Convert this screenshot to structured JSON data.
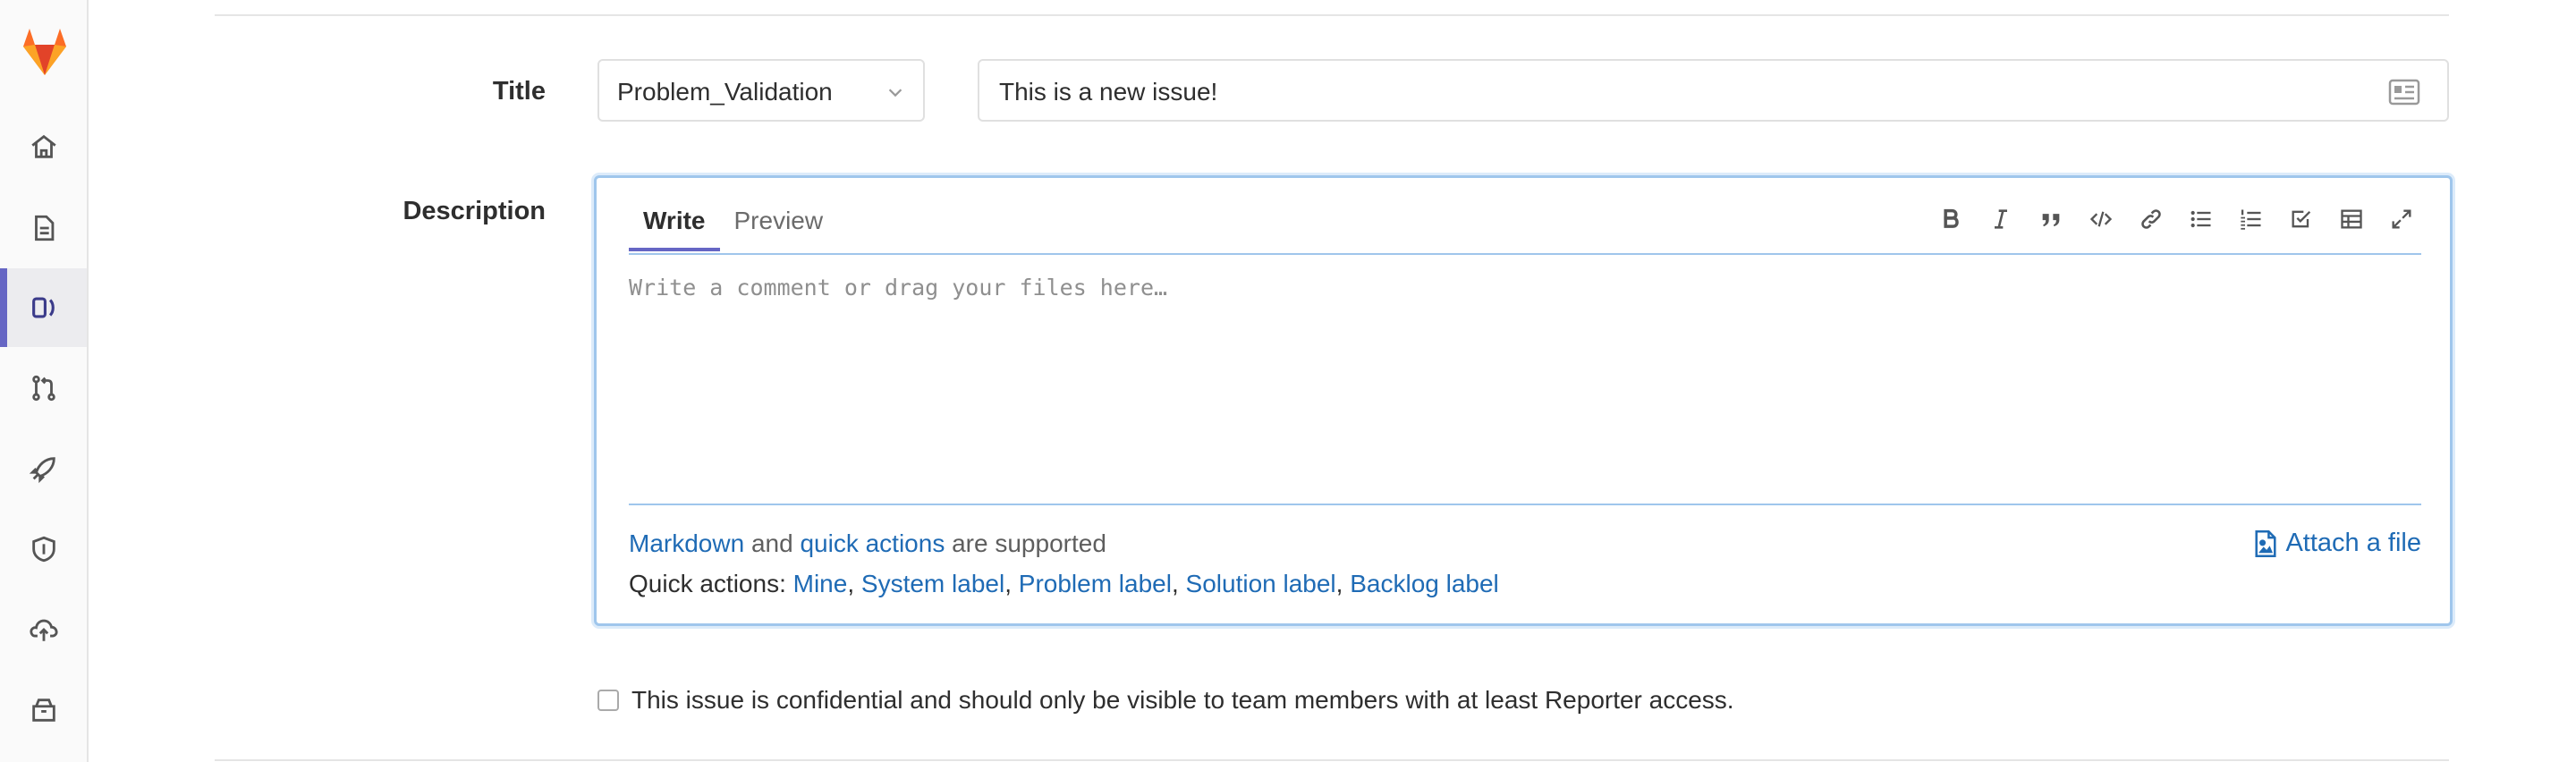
{
  "sidebar": {
    "items": [
      {
        "icon": "home-icon"
      },
      {
        "icon": "document-icon"
      },
      {
        "icon": "issues-icon",
        "active": true
      },
      {
        "icon": "merge-request-icon"
      },
      {
        "icon": "rocket-icon"
      },
      {
        "icon": "shield-icon"
      },
      {
        "icon": "cloud-upload-icon"
      },
      {
        "icon": "package-icon"
      }
    ]
  },
  "form": {
    "title_label": "Title",
    "template_value": "Problem_Validation",
    "title_value": "This is a new issue!",
    "description_label": "Description",
    "tabs": [
      "Write",
      "Preview"
    ],
    "placeholder": "Write a comment or drag your files here…",
    "markdown_link": "Markdown",
    "and_text": "and",
    "quick_actions_link": "quick actions",
    "supported_text": "are supported",
    "quick_actions_label": "Quick actions:",
    "quick_action_items": [
      "Mine",
      "System label",
      "Problem label",
      "Solution label",
      "Backlog label"
    ],
    "attach_label": "Attach a file",
    "confidential_text": "This issue is confidential and should only be visible to team members with at least Reporter access."
  },
  "colors": {
    "accent": "#6666c4",
    "link": "#1f6bb5",
    "focus_border": "#9fc6ec"
  }
}
